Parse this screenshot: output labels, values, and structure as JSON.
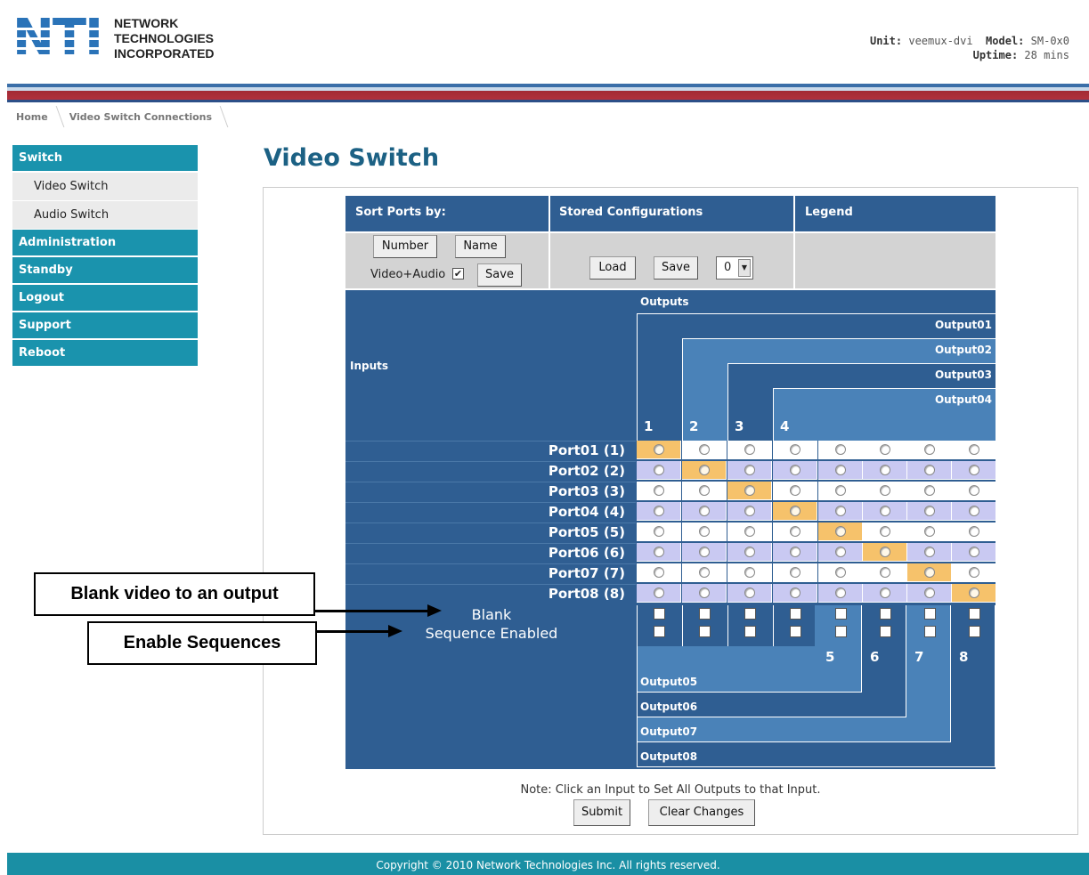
{
  "header": {
    "logo_line1": "NETWORK",
    "logo_line2": "TECHNOLOGIES",
    "logo_line3": "INCORPORATED",
    "logo_mark": "NTI",
    "unit_label": "Unit:",
    "unit_value": "veemux-dvi",
    "model_label": "Model:",
    "model_value": "SM-0x0",
    "uptime_label": "Uptime:",
    "uptime_value": "28 mins"
  },
  "breadcrumb": [
    "Home",
    "Video Switch Connections"
  ],
  "sidebar": [
    {
      "label": "Switch",
      "type": "head"
    },
    {
      "label": "Video Switch",
      "type": "sub"
    },
    {
      "label": "Audio Switch",
      "type": "sub"
    },
    {
      "label": "Administration",
      "type": "head"
    },
    {
      "label": "Standby",
      "type": "head"
    },
    {
      "label": "Logout",
      "type": "head"
    },
    {
      "label": "Support",
      "type": "head"
    },
    {
      "label": "Reboot",
      "type": "head"
    }
  ],
  "page_title": "Video Switch",
  "controls": {
    "sort_header": "Sort Ports by:",
    "stored_header": "Stored Configurations",
    "legend_header": "Legend",
    "number_button": "Number",
    "name_button": "Name",
    "video_audio_label": "Video+Audio",
    "video_audio_checked": true,
    "save_sort_button": "Save",
    "load_button": "Load",
    "save_config_button": "Save",
    "config_select_value": "0"
  },
  "matrix": {
    "outputs_label": "Outputs",
    "inputs_label": "Inputs",
    "outputs_top": [
      "Output01",
      "Output02",
      "Output03",
      "Output04"
    ],
    "outputs_bottom": [
      "Output05",
      "Output06",
      "Output07",
      "Output08"
    ],
    "col_numbers_top": [
      "1",
      "2",
      "3",
      "4"
    ],
    "col_numbers_bottom": [
      "5",
      "6",
      "7",
      "8"
    ],
    "rows": [
      "Port01 (1)",
      "Port02 (2)",
      "Port03 (3)",
      "Port04 (4)",
      "Port05 (5)",
      "Port06 (6)",
      "Port07 (7)",
      "Port08 (8)"
    ],
    "selected": [
      1,
      2,
      3,
      4,
      5,
      6,
      7,
      8
    ],
    "blank_label": "Blank",
    "sequence_label": "Sequence Enabled",
    "colors": {
      "selected": "#f6c26b",
      "row_odd": "#ffffff",
      "row_even": "#c9c9f2",
      "blue": "#2f5e92"
    }
  },
  "note": "Note: Click an Input to Set All Outputs to that Input.",
  "submit_button": "Submit",
  "clear_button": "Clear Changes",
  "footer": "Copyright © 2010 Network Technologies Inc. All rights reserved.",
  "callouts": {
    "blank": "Blank video to an output",
    "sequences": "Enable Sequences"
  }
}
